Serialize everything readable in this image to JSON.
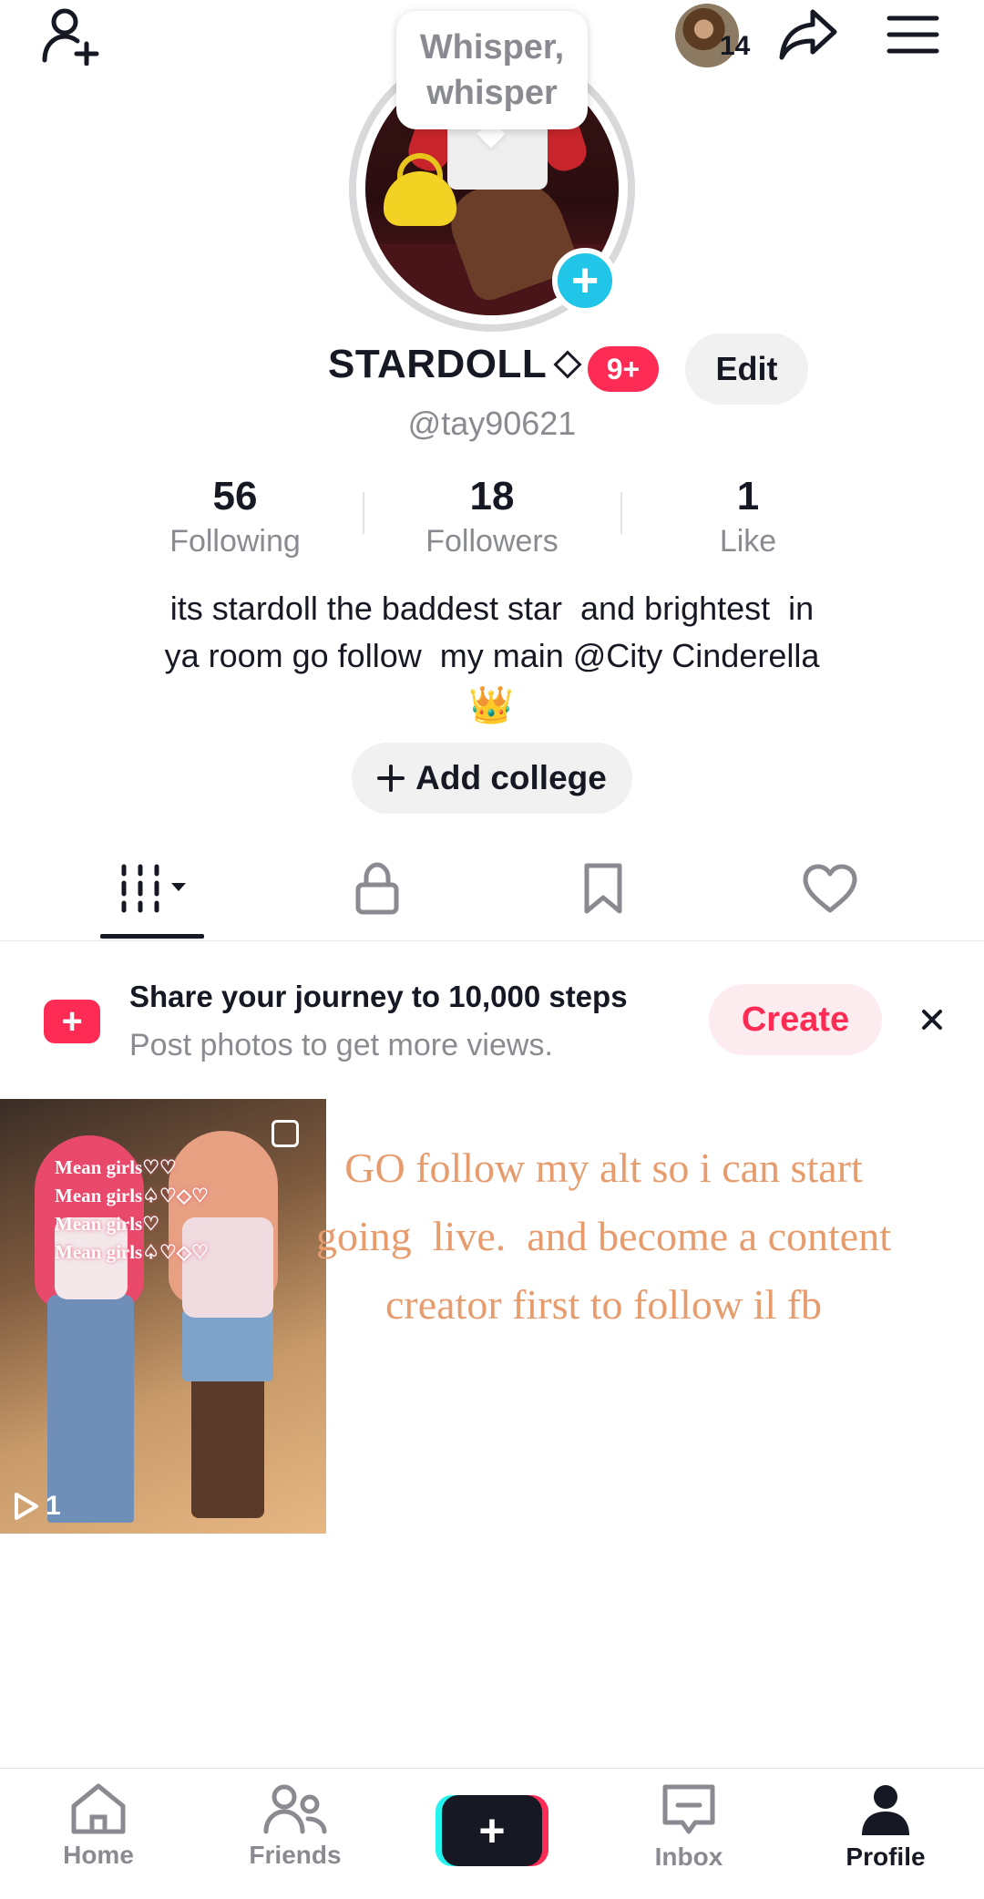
{
  "topbar": {
    "add_friend_icon": "person-plus-icon",
    "story_count": "14",
    "share_icon": "share-arrow-icon",
    "menu_icon": "hamburger-menu-icon"
  },
  "whisper_bubble": {
    "line1": "Whisper,",
    "line2": "whisper"
  },
  "profile": {
    "display_name": "STARDOLL",
    "notification_badge": "9+",
    "edit_label": "Edit",
    "handle": "@tay90621"
  },
  "stats": [
    {
      "value": "56",
      "label": "Following"
    },
    {
      "value": "18",
      "label": "Followers"
    },
    {
      "value": "1",
      "label": "Like"
    }
  ],
  "bio": {
    "line1": "its stardoll the baddest star  and brightest  in",
    "line2": "ya room go follow  my main @City Cinderella",
    "emoji": "👑"
  },
  "add_college_label": "Add college",
  "tabs": [
    {
      "name": "videos",
      "icon": "grid-dropdown-icon",
      "active": true
    },
    {
      "name": "private",
      "icon": "lock-icon"
    },
    {
      "name": "saved",
      "icon": "bookmark-icon"
    },
    {
      "name": "liked",
      "icon": "heart-icon"
    }
  ],
  "banner": {
    "title": "Share your journey to 10,000 steps",
    "subtitle": "Post photos to get more views.",
    "create_label": "Create"
  },
  "video": {
    "overlay_lines": [
      "Mean girls♡♡",
      "Mean girls♤♡◇♡",
      "Mean girls♡",
      "Mean girls♤♡◇♡"
    ],
    "play_count": "1"
  },
  "post_caption": "GO follow my alt so i can start going  live.  and become a content creator first to follow il fb",
  "bottom_nav": [
    {
      "label": "Home",
      "icon": "home-icon"
    },
    {
      "label": "Friends",
      "icon": "friends-icon"
    },
    {
      "label": "",
      "icon": "create-plus-icon"
    },
    {
      "label": "Inbox",
      "icon": "inbox-icon"
    },
    {
      "label": "Profile",
      "icon": "profile-icon",
      "active": true
    }
  ],
  "colors": {
    "accent_pink": "#fe2c55",
    "accent_cyan": "#20c5e8",
    "text_primary": "#161823",
    "text_secondary": "#8a8b91",
    "caption_orange": "#e79c6e"
  }
}
